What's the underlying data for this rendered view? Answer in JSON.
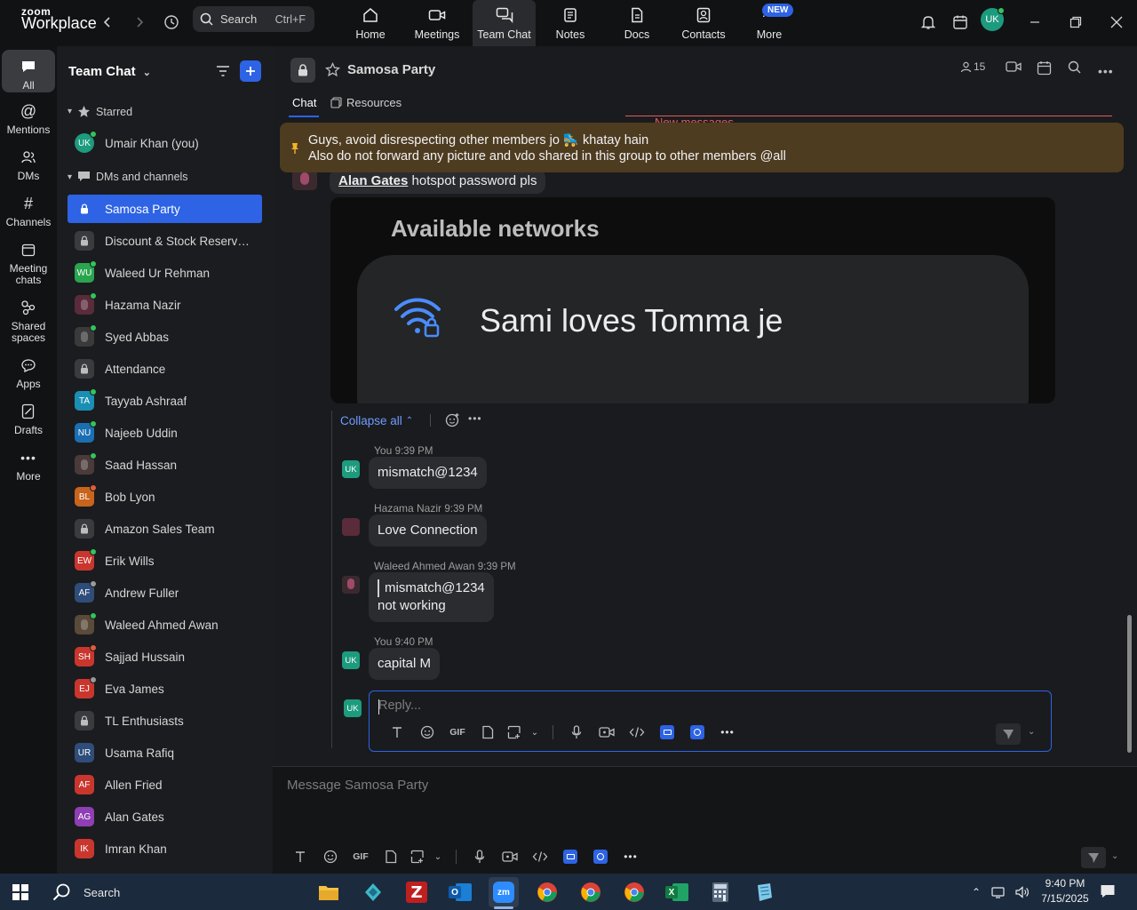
{
  "app": {
    "logo_small": "zoom",
    "logo_big": "Workplace"
  },
  "search": {
    "label": "Search",
    "shortcut": "Ctrl+F"
  },
  "nav_tabs": [
    {
      "label": "Home",
      "icon": "home-icon"
    },
    {
      "label": "Meetings",
      "icon": "video-icon"
    },
    {
      "label": "Team Chat",
      "icon": "chat-icon"
    },
    {
      "label": "Notes",
      "icon": "notes-icon"
    },
    {
      "label": "Docs",
      "icon": "docs-icon"
    },
    {
      "label": "Contacts",
      "icon": "contacts-icon"
    },
    {
      "label": "More",
      "icon": "more-icon"
    }
  ],
  "new_badge": "NEW",
  "user_initials": "UK",
  "rail": [
    {
      "label": "All"
    },
    {
      "label": "Mentions"
    },
    {
      "label": "DMs"
    },
    {
      "label": "Channels"
    },
    {
      "label": "Meeting chats"
    },
    {
      "label": "Shared spaces"
    },
    {
      "label": "Apps"
    },
    {
      "label": "Drafts"
    },
    {
      "label": "More"
    }
  ],
  "sidebar": {
    "title": "Team Chat",
    "starred_label": "Starred",
    "dms_label": "DMs and channels",
    "starred": [
      {
        "label": "Umair Khan (you)",
        "initials": "UK",
        "color": "#1d9b7e",
        "dot": "#33c45a"
      }
    ],
    "items": [
      {
        "label": "Samosa Party",
        "initials": "",
        "type": "lock",
        "active": true
      },
      {
        "label": "Discount & Stock Reservati...",
        "initials": "",
        "type": "lock"
      },
      {
        "label": "Waleed Ur Rehman",
        "initials": "WU",
        "color": "#2aa44f",
        "dot": "#33c45a"
      },
      {
        "label": "Hazama Nazir",
        "initials": "",
        "color": "#5a2b3a",
        "dot": "#33c45a"
      },
      {
        "label": "Syed Abbas",
        "initials": "",
        "color": "#3a3a3a",
        "dot": "#33c45a"
      },
      {
        "label": "Attendance",
        "initials": "",
        "type": "lock"
      },
      {
        "label": "Tayyab Ashraaf",
        "initials": "TA",
        "color": "#1a8fb3",
        "dot": "#33c45a"
      },
      {
        "label": "Najeeb Uddin",
        "initials": "NU",
        "color": "#1a6fb3",
        "dot": "#33c45a"
      },
      {
        "label": "Saad Hassan",
        "initials": "",
        "color": "#4a3a3a",
        "dot": "#33c45a"
      },
      {
        "label": "Bob Lyon",
        "initials": "BL",
        "color": "#c8641c",
        "dot": "#e05c3c"
      },
      {
        "label": "Amazon Sales Team",
        "initials": "",
        "type": "lock"
      },
      {
        "label": "Erik Wills",
        "initials": "EW",
        "color": "#c9362e",
        "dot": "#33c45a"
      },
      {
        "label": "Andrew Fuller",
        "initials": "AF",
        "color": "#2e4d7a",
        "dot": "#9a9a9a"
      },
      {
        "label": "Waleed Ahmed Awan",
        "initials": "",
        "color": "#5a4a3a",
        "dot": "#33c45a"
      },
      {
        "label": "Sajjad Hussain",
        "initials": "SH",
        "color": "#c9362e",
        "dot": "#e05c3c"
      },
      {
        "label": "Eva James",
        "initials": "EJ",
        "color": "#c9362e",
        "dot": "#9a9a9a"
      },
      {
        "label": "TL Enthusiasts",
        "initials": "",
        "type": "lock"
      },
      {
        "label": "Usama Rafiq",
        "initials": "UR",
        "color": "#2e4d7a",
        "dot": ""
      },
      {
        "label": "Allen Fried",
        "initials": "AF",
        "color": "#c9362e",
        "dot": ""
      },
      {
        "label": "Alan Gates",
        "initials": "AG",
        "color": "#8e3fb3",
        "dot": ""
      },
      {
        "label": "Imran Khan",
        "initials": "IK",
        "color": "#c9362e",
        "dot": ""
      }
    ]
  },
  "channel": {
    "title": "Samosa Party",
    "member_count": "15",
    "tabs": {
      "chat": "Chat",
      "resources": "Resources"
    },
    "new_messages_label": "New messages",
    "pinned_line1": "Guys, avoid disrespecting other members jo 🛼 khatay hain",
    "pinned_line2": "Also do not forward any picture and vdo shared in this group to other members @all"
  },
  "thread": {
    "root_author": "Alan Gates",
    "root_text": "hotspot password pls",
    "image_heading": "Available networks",
    "image_network": "Sami loves Tomma je",
    "collapse_label": "Collapse all",
    "replies": [
      {
        "author": "You",
        "time": "9:39 PM",
        "text": "mismatch@1234",
        "avatar": "UK"
      },
      {
        "author": "Hazama Nazir",
        "time": "9:39 PM",
        "text": "Love Connection",
        "avatar": ""
      },
      {
        "author": "Waleed Ahmed Awan",
        "time": "9:39 PM",
        "quote": "mismatch@1234",
        "text": "not working",
        "avatar": ""
      },
      {
        "author": "You",
        "time": "9:40 PM",
        "text": "capital M",
        "avatar": "UK"
      }
    ],
    "reply_placeholder": "Reply...",
    "reply_avatar": "UK"
  },
  "composer": {
    "placeholder": "Message Samosa Party",
    "gif_label": "GIF"
  },
  "taskbar": {
    "search_label": "Search",
    "time": "9:40 PM",
    "date": "7/15/2025"
  },
  "colors": {
    "accent": "#2d63e4",
    "pinned_bg": "#4e3c21",
    "online": "#33c45a",
    "new_messages": "#e05c5c"
  }
}
